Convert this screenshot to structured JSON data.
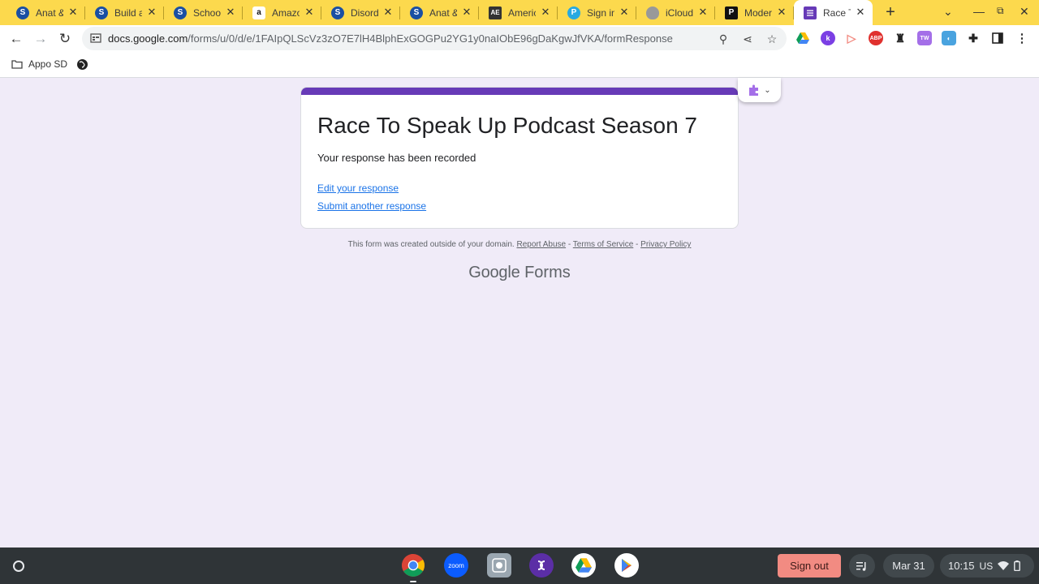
{
  "browser": {
    "tabs": [
      {
        "title": "Anat &",
        "favicon": "S",
        "color": "#1a4fa3"
      },
      {
        "title": "Build a",
        "favicon": "S",
        "color": "#1a4fa3"
      },
      {
        "title": "School",
        "favicon": "S",
        "color": "#1a4fa3"
      },
      {
        "title": "Amazo",
        "favicon": "a",
        "color": "#111111"
      },
      {
        "title": "Disorde",
        "favicon": "S",
        "color": "#1a4fa3"
      },
      {
        "title": "Anat &",
        "favicon": "S",
        "color": "#1a4fa3"
      },
      {
        "title": "Americ",
        "favicon": "AE",
        "color": "#333333"
      },
      {
        "title": "Sign in",
        "favicon": "P",
        "color": "#27a9e1"
      },
      {
        "title": "iCloud",
        "favicon": "",
        "color": "#888888"
      },
      {
        "title": "Moder",
        "favicon": "P",
        "color": "#111111"
      },
      {
        "title": "Race T",
        "favicon": "",
        "color": "#673ab7"
      }
    ],
    "url_domain": "docs.google.com",
    "url_path": "/forms/u/0/d/e/1FAIpQLScVz3zO7E7lH4BlphExGOGPu2YG1y0naIObE96gDaKgwJfVKA/formResponse",
    "bookmarks": [
      {
        "label": "Appo SD"
      }
    ]
  },
  "form": {
    "title": "Race To Speak Up Podcast Season 7",
    "confirmation": "Your response has been recorded",
    "edit_link": "Edit your response",
    "submit_another_link": "Submit another response"
  },
  "footer": {
    "note": "This form was created outside of your domain.",
    "report_abuse": "Report Abuse",
    "terms": "Terms of Service",
    "privacy": "Privacy Policy",
    "sep1": " - ",
    "sep2": " - ",
    "brand_google": "Google",
    "brand_forms": "Forms"
  },
  "shelf": {
    "sign_out": "Sign out",
    "date": "Mar 31",
    "time": "10:15",
    "locale": "US"
  },
  "colors": {
    "tab_strip": "#fcd94d",
    "form_accent": "#673ab7",
    "page_background": "#f0ebf8",
    "sign_out": "#f28b82"
  }
}
